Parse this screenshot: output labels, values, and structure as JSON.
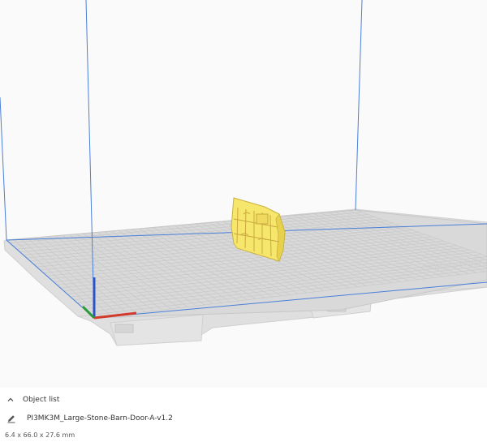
{
  "object_list": {
    "collapse_icon": "chevron-up-icon",
    "title": "Object list",
    "item_icon": "pencil-icon",
    "item_name": "PI3MK3M_Large-Stone-Barn-Door-A-v1.2",
    "dimensions": "6.4 x 66.0 x 27.6 mm"
  },
  "viewport": {
    "background_color": "#fafafa",
    "build_plate_color": "#d9d9d9",
    "grid_color": "#c6c6c6",
    "volume_outline_color": "#4a7fd8",
    "model_color": "#f6e66c",
    "axis_colors": {
      "x": "#d23b2b",
      "y": "#2b9a3a",
      "z": "#2a55c8"
    }
  }
}
